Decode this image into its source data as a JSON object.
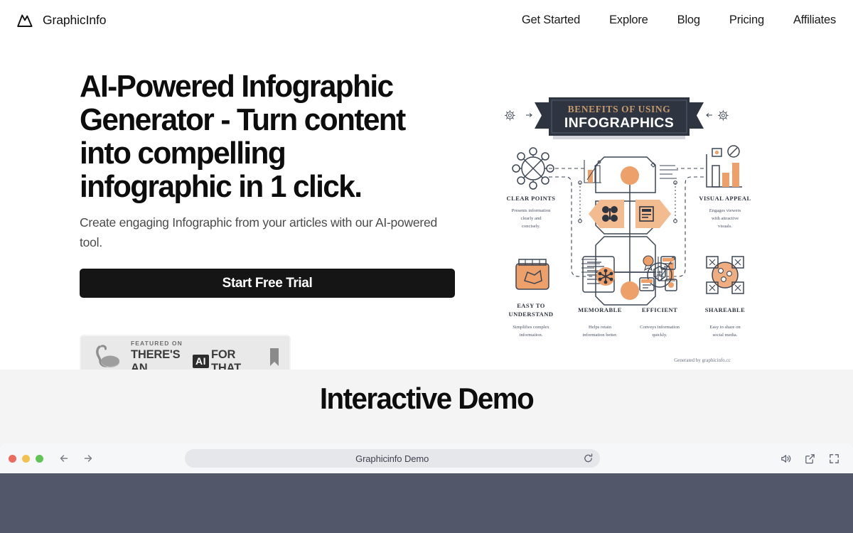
{
  "header": {
    "brand_name": "GraphicInfo",
    "logo_icon": "mountain-peak-icon",
    "nav": [
      {
        "label": "Get Started"
      },
      {
        "label": "Explore"
      },
      {
        "label": "Blog"
      },
      {
        "label": "Pricing"
      },
      {
        "label": "Affiliates"
      }
    ]
  },
  "hero": {
    "title": "AI-Powered Infographic Generator - Turn content into compelling infographic in 1 click.",
    "subtitle": "Create engaging Infographic from your articles with our AI-powered tool.",
    "cta_label": "Start Free Trial",
    "badge": {
      "featured_label": "FEATURED ON",
      "line_prefix": "THERE'S AN",
      "line_chip": "AI",
      "line_suffix": "FOR THAT",
      "arm_icon": "flexed-arm-icon",
      "bookmark_icon": "bookmark-icon"
    }
  },
  "infographic": {
    "banner_top": "BENEFITS OF USING",
    "banner_bottom": "INFOGRAPHICS",
    "left_gear_icon": "gear-icon",
    "right_gear_icon": "gear-icon",
    "items": [
      {
        "title": "CLEAR POINTS",
        "desc_lines": [
          "Presents information",
          "clearly and",
          "concisely."
        ],
        "icon": "network-node-icon"
      },
      {
        "title": "VISUAL APPEAL",
        "desc_lines": [
          "Engages viewers",
          "with attractive",
          "visuals."
        ],
        "icon": "bar-chart-icon"
      },
      {
        "title": "EASY TO UNDERSTAND",
        "desc_lines": [
          "Simplifies complex",
          "information."
        ],
        "icon": "puzzle-box-icon"
      },
      {
        "title": "MEMORABLE",
        "desc_lines": [
          "Helps retain",
          "information better."
        ],
        "icon": "document-brain-icon"
      },
      {
        "title": "EFFICIENT",
        "desc_lines": [
          "Conveys information",
          "quickly."
        ],
        "icon": "workflow-icon"
      },
      {
        "title": "SHAREABLE",
        "desc_lines": [
          "Easy to share on",
          "social media."
        ],
        "icon": "share-network-icon"
      }
    ],
    "credit": "Generated by graphicinfo.cc",
    "colors": {
      "accent_orange": "#eda06a",
      "banner_navy": "#2e3440",
      "banner_gold": "#c4996c",
      "outline": "#3d4654"
    }
  },
  "demo": {
    "section_title": "Interactive Demo",
    "browser": {
      "url_text": "Graphicinfo Demo",
      "back_icon": "arrow-left-icon",
      "forward_icon": "arrow-right-icon",
      "refresh_icon": "refresh-icon",
      "volume_icon": "volume-icon",
      "share_icon": "external-link-icon",
      "fullscreen_icon": "fullscreen-icon",
      "dots": [
        "close-dot",
        "minimize-dot",
        "maximize-dot"
      ],
      "viewport_color": "#52586a"
    }
  }
}
